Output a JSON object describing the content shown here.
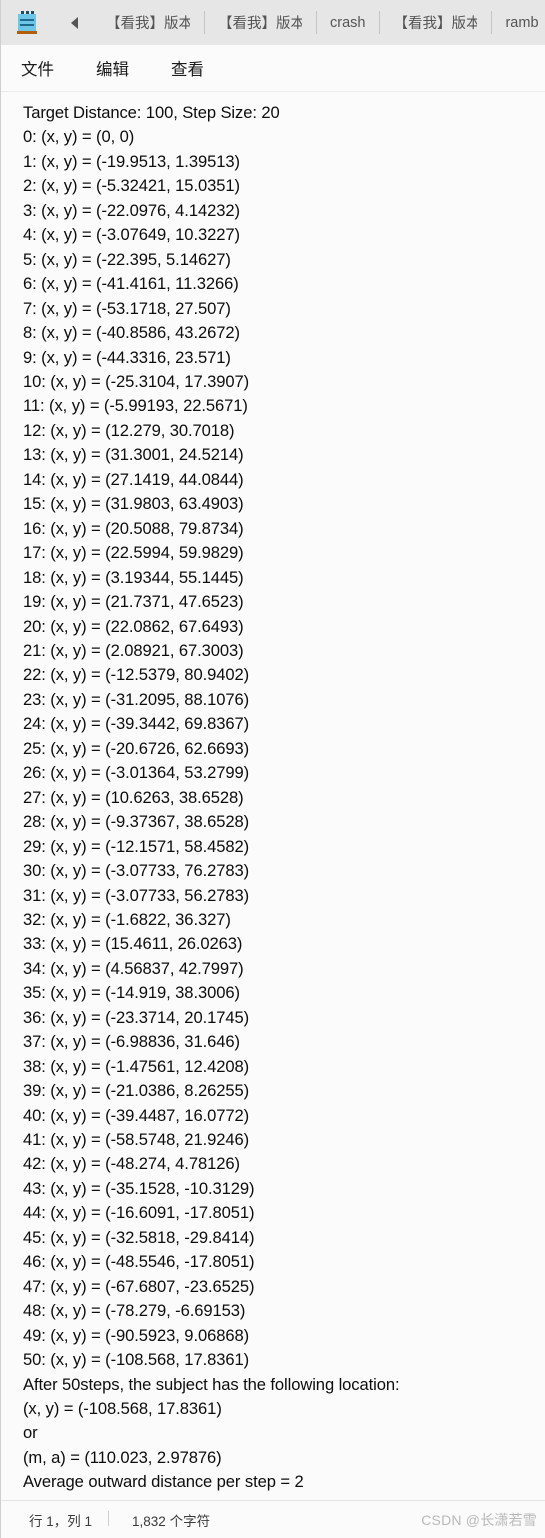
{
  "window": {
    "app_icon": "notepad-icon",
    "accent": "#6ec6e6",
    "titlebar_bg": "#e6e6e6",
    "editor_bg": "#fbfbfb"
  },
  "titlebar": {
    "back_icon": "caret-left-icon",
    "tabs": [
      {
        "label": "【看我】版本",
        "active": false
      },
      {
        "label": "【看我】版本",
        "active": false
      },
      {
        "label": "crash",
        "active": false
      },
      {
        "label": "【看我】版本",
        "active": false
      },
      {
        "label": "ramb",
        "active": false
      }
    ]
  },
  "menubar": {
    "items": [
      {
        "label": "文件"
      },
      {
        "label": "编辑"
      },
      {
        "label": "查看"
      }
    ]
  },
  "editor": {
    "lines": [
      "Target Distance: 100, Step Size: 20",
      "0: (x, y) = (0, 0)",
      "1: (x, y) = (-19.9513, 1.39513)",
      "2: (x, y) = (-5.32421, 15.0351)",
      "3: (x, y) = (-22.0976, 4.14232)",
      "4: (x, y) = (-3.07649, 10.3227)",
      "5: (x, y) = (-22.395, 5.14627)",
      "6: (x, y) = (-41.4161, 11.3266)",
      "7: (x, y) = (-53.1718, 27.507)",
      "8: (x, y) = (-40.8586, 43.2672)",
      "9: (x, y) = (-44.3316, 23.571)",
      "10: (x, y) = (-25.3104, 17.3907)",
      "11: (x, y) = (-5.99193, 22.5671)",
      "12: (x, y) = (12.279, 30.7018)",
      "13: (x, y) = (31.3001, 24.5214)",
      "14: (x, y) = (27.1419, 44.0844)",
      "15: (x, y) = (31.9803, 63.4903)",
      "16: (x, y) = (20.5088, 79.8734)",
      "17: (x, y) = (22.5994, 59.9829)",
      "18: (x, y) = (3.19344, 55.1445)",
      "19: (x, y) = (21.7371, 47.6523)",
      "20: (x, y) = (22.0862, 67.6493)",
      "21: (x, y) = (2.08921, 67.3003)",
      "22: (x, y) = (-12.5379, 80.9402)",
      "23: (x, y) = (-31.2095, 88.1076)",
      "24: (x, y) = (-39.3442, 69.8367)",
      "25: (x, y) = (-20.6726, 62.6693)",
      "26: (x, y) = (-3.01364, 53.2799)",
      "27: (x, y) = (10.6263, 38.6528)",
      "28: (x, y) = (-9.37367, 38.6528)",
      "29: (x, y) = (-12.1571, 58.4582)",
      "30: (x, y) = (-3.07733, 76.2783)",
      "31: (x, y) = (-3.07733, 56.2783)",
      "32: (x, y) = (-1.6822, 36.327)",
      "33: (x, y) = (15.4611, 26.0263)",
      "34: (x, y) = (4.56837, 42.7997)",
      "35: (x, y) = (-14.919, 38.3006)",
      "36: (x, y) = (-23.3714, 20.1745)",
      "37: (x, y) = (-6.98836, 31.646)",
      "38: (x, y) = (-1.47561, 12.4208)",
      "39: (x, y) = (-21.0386, 8.26255)",
      "40: (x, y) = (-39.4487, 16.0772)",
      "41: (x, y) = (-58.5748, 21.9246)",
      "42: (x, y) = (-48.274, 4.78126)",
      "43: (x, y) = (-35.1528, -10.3129)",
      "44: (x, y) = (-16.6091, -17.8051)",
      "45: (x, y) = (-32.5818, -29.8414)",
      "46: (x, y) = (-48.5546, -17.8051)",
      "47: (x, y) = (-67.6807, -23.6525)",
      "48: (x, y) = (-78.279, -6.69153)",
      "49: (x, y) = (-90.5923, 9.06868)",
      "50: (x, y) = (-108.568, 17.8361)",
      "After 50steps, the subject has the following location:",
      "(x, y) = (-108.568, 17.8361)",
      "or",
      "(m, a) = (110.023, 2.97876)",
      "Average outward distance per step = 2"
    ]
  },
  "statusbar": {
    "caret_position": "行 1，列 1",
    "char_count": "1,832 个字符",
    "watermark": "CSDN @长潇若雪"
  }
}
